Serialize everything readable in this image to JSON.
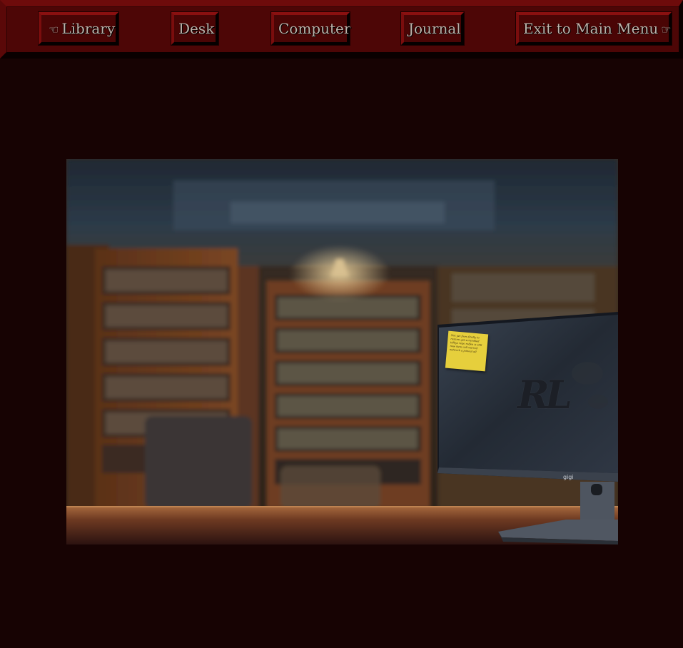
{
  "nav": {
    "library": {
      "arrow": "☜",
      "label": "Library"
    },
    "desk": {
      "label": "Desk"
    },
    "computer": {
      "label": "Computer"
    },
    "journal": {
      "label": "Journal"
    },
    "exit": {
      "label": "Exit to Main Menu",
      "arrow": "☞"
    }
  },
  "scene": {
    "sticky_note_text": "Not yet fixes finally to restore get scrambled tidbys repo rolfen is still now here call warred network a joinout all",
    "monitor_logo": "RL",
    "monitor_brand": "gigi"
  },
  "colors": {
    "page_background": "#170303",
    "nav_background": "#4d0606",
    "button_text": "#b9b0a8",
    "sticky_note": "#e6cf3c"
  }
}
